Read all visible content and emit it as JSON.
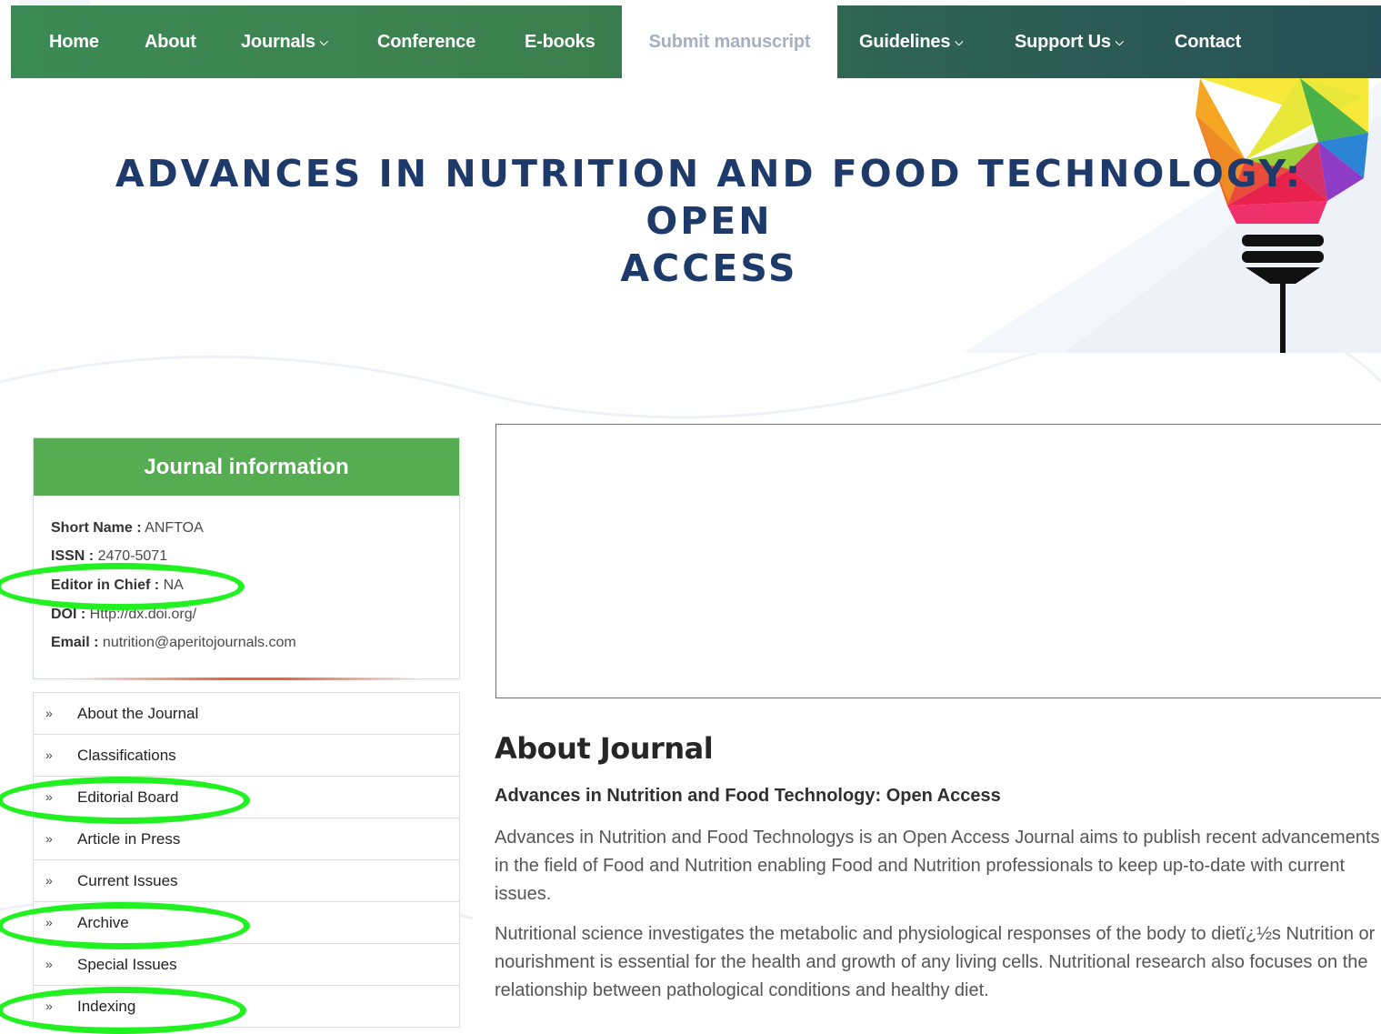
{
  "nav": {
    "items": [
      {
        "label": "Home",
        "dropdown": false
      },
      {
        "label": "About",
        "dropdown": false
      },
      {
        "label": "Journals",
        "dropdown": true
      },
      {
        "label": "Conference",
        "dropdown": false
      },
      {
        "label": "E-books",
        "dropdown": false
      },
      {
        "label": "Submit manuscript",
        "dropdown": false,
        "active": true
      },
      {
        "label": "Guidelines",
        "dropdown": true
      },
      {
        "label": "Support Us",
        "dropdown": true
      },
      {
        "label": "Contact",
        "dropdown": false
      }
    ]
  },
  "hero": {
    "title_line1": "ADVANCES IN NUTRITION AND FOOD TECHNOLOGY: OPEN",
    "title_line2": "ACCESS"
  },
  "journal_info": {
    "heading": "Journal information",
    "short_name_label": "Short Name :",
    "short_name": "ANFTOA",
    "issn_label": "ISSN :",
    "issn": "2470-5071",
    "editor_label": "Editor in Chief :",
    "editor": "NA",
    "doi_label": "DOI :",
    "doi": "Http://dx.doi.org/",
    "email_label": "Email :",
    "email": "nutrition@aperitojournals.com"
  },
  "side_menu": {
    "arrow": "»",
    "items": [
      "About the Journal",
      "Classifications",
      "Editorial Board",
      "Article in Press",
      "Current Issues",
      "Archive",
      "Special Issues",
      "Indexing"
    ]
  },
  "main": {
    "heading": "About Journal",
    "subheading": "Advances in Nutrition and Food Technology: Open Access",
    "para1": "Advances in Nutrition and Food Technologys is an Open Access Journal aims to publish recent advancements in the field of Food and Nutrition enabling Food and Nutrition professionals to keep up-to-date with current issues.",
    "para2": "Nutritional science investigates the metabolic and physiological responses of the body to dietï¿½s Nutrition or nourishment is essential for the health and growth of any living cells. Nutritional research also focuses on the relationship between pathological conditions and healthy diet."
  },
  "colors": {
    "nav_green": "#3c8a55",
    "nav_teal": "#274f57",
    "title_navy": "#1e3a6b",
    "panel_green": "#56ad51",
    "annotation_green": "#21f121",
    "accent_orange": "#e06640"
  },
  "icons": {
    "dropdown": "chevron-down-icon",
    "menu_bullet": "double-chevron-right-icon",
    "hero_art": "lightbulb-illustration"
  }
}
